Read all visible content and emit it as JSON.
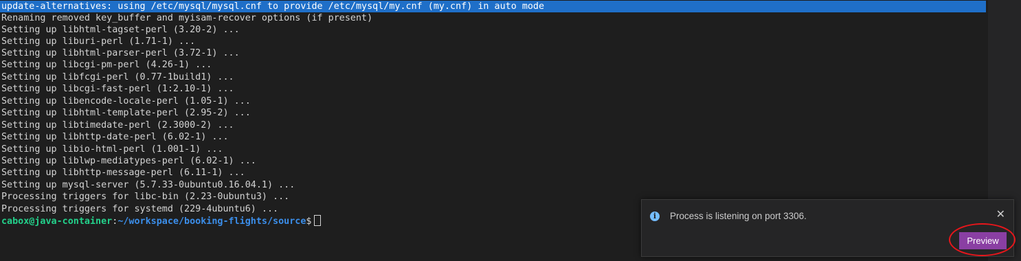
{
  "terminal": {
    "selected_line": "update-alternatives: using /etc/mysql/mysql.cnf to provide /etc/mysql/my.cnf (my.cnf) in auto mode",
    "lines": [
      "Renaming removed key_buffer and myisam-recover options (if present)",
      "Setting up libhtml-tagset-perl (3.20-2) ...",
      "Setting up liburi-perl (1.71-1) ...",
      "Setting up libhtml-parser-perl (3.72-1) ...",
      "Setting up libcgi-pm-perl (4.26-1) ...",
      "Setting up libfcgi-perl (0.77-1build1) ...",
      "Setting up libcgi-fast-perl (1:2.10-1) ...",
      "Setting up libencode-locale-perl (1.05-1) ...",
      "Setting up libhtml-template-perl (2.95-2) ...",
      "Setting up libtimedate-perl (2.3000-2) ...",
      "Setting up libhttp-date-perl (6.02-1) ...",
      "Setting up libio-html-perl (1.001-1) ...",
      "Setting up liblwp-mediatypes-perl (6.02-1) ...",
      "Setting up libhttp-message-perl (6.11-1) ...",
      "Setting up mysql-server (5.7.33-0ubuntu0.16.04.1) ...",
      "Processing triggers for libc-bin (2.23-0ubuntu3) ...",
      "Processing triggers for systemd (229-4ubuntu6) ..."
    ],
    "prompt": {
      "user_host": "cabox@java-container",
      "separator": ":",
      "path": "~/workspace/booking-flights/source",
      "symbol": "$"
    }
  },
  "notification": {
    "icon": "info-icon",
    "message": "Process is listening on port 3306.",
    "close_icon": "close-icon",
    "close_glyph": "✕",
    "action_label": "Preview"
  },
  "colors": {
    "terminal_bg": "#1e1e1e",
    "selection": "#1f6fc8",
    "prompt_user": "#23d18b",
    "prompt_path": "#3b8eea",
    "preview_button": "#8a3fa3",
    "highlight_ring": "#e8161b"
  }
}
